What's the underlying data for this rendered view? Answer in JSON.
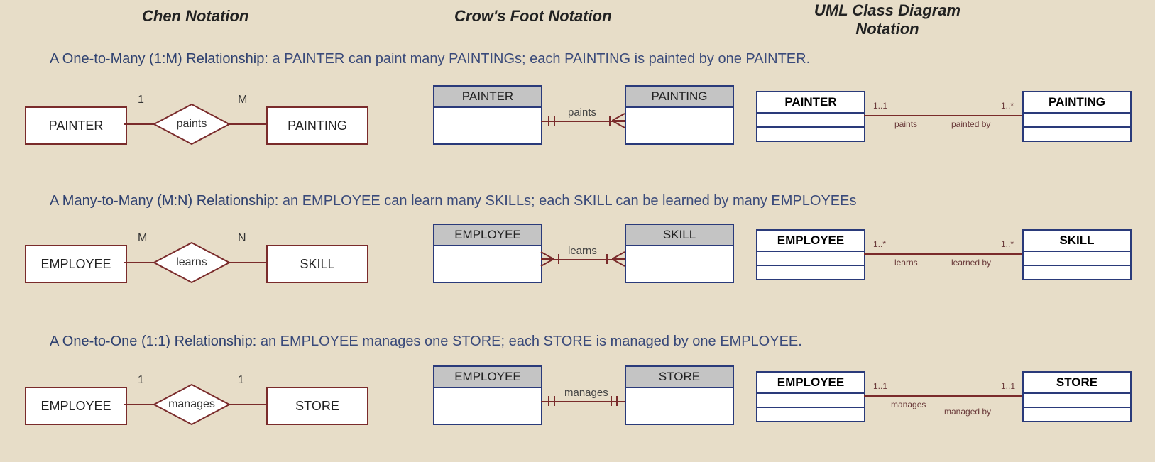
{
  "headers": {
    "chen": "Chen Notation",
    "crows": "Crow's Foot Notation",
    "uml": "UML Class Diagram Notation"
  },
  "rows": [
    {
      "caption_lead": "A One-to-Many (1:M) Relationship:",
      "caption_rest": " a PAINTER can paint many PAINTINGs; each PAINTING is painted by one PAINTER.",
      "chen": {
        "left": "PAINTER",
        "right": "PAINTING",
        "rel": "paints",
        "lcard": "1",
        "rcard": "M"
      },
      "cf": {
        "left": "PAINTER",
        "right": "PAINTING",
        "rel": "paints",
        "left_end": "one",
        "right_end": "many"
      },
      "uml": {
        "left": "PAINTER",
        "right": "PAINTING",
        "lmult": "1..1",
        "rmult": "1..*",
        "lrole": "paints",
        "rrole": "painted by"
      }
    },
    {
      "caption_lead": "A Many-to-Many (M:N) Relationship:",
      "caption_rest": " an EMPLOYEE can learn many SKILLs; each SKILL can be learned by many EMPLOYEEs",
      "chen": {
        "left": "EMPLOYEE",
        "right": "SKILL",
        "rel": "learns",
        "lcard": "M",
        "rcard": "N"
      },
      "cf": {
        "left": "EMPLOYEE",
        "right": "SKILL",
        "rel": "learns",
        "left_end": "many",
        "right_end": "many"
      },
      "uml": {
        "left": "EMPLOYEE",
        "right": "SKILL",
        "lmult": "1..*",
        "rmult": "1..*",
        "lrole": "learns",
        "rrole": "learned by"
      }
    },
    {
      "caption_lead": "A One-to-One (1:1) Relationship:",
      "caption_rest": " an EMPLOYEE manages one STORE; each STORE is managed by one EMPLOYEE.",
      "chen": {
        "left": "EMPLOYEE",
        "right": "STORE",
        "rel": "manages",
        "lcard": "1",
        "rcard": "1"
      },
      "cf": {
        "left": "EMPLOYEE",
        "right": "STORE",
        "rel": "manages",
        "left_end": "one",
        "right_end": "one"
      },
      "uml": {
        "left": "EMPLOYEE",
        "right": "STORE",
        "lmult": "1..1",
        "rmult": "1..1",
        "lrole": "manages",
        "rrole": "managed by"
      }
    }
  ],
  "colors": {
    "line": "#7a2b2b",
    "entity_border": "#2a3a7a"
  }
}
